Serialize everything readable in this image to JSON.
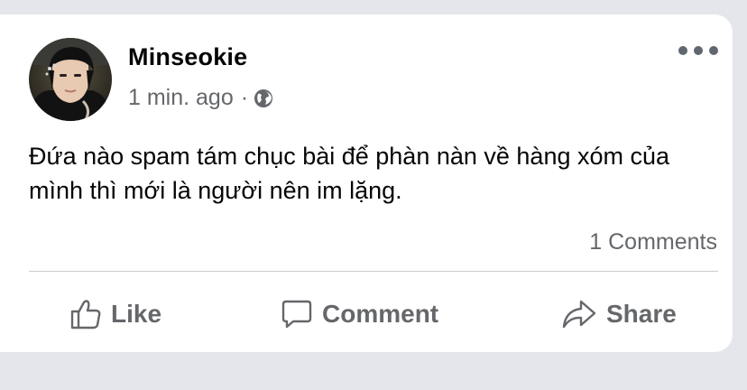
{
  "post": {
    "author": "Minseokie",
    "timestamp": "1 min. ago",
    "separator": "·",
    "privacy_icon": "globe-icon",
    "text": "Đứa nào spam tám chục bài để phàn nàn về hàng xóm của mình thì mới là người nên im lặng.",
    "comments_count": "1 Comments"
  },
  "actions": {
    "like_label": "Like",
    "comment_label": "Comment",
    "share_label": "Share"
  },
  "colors": {
    "background": "#e4e6eb",
    "card": "#ffffff",
    "primary_text": "#050505",
    "secondary_text": "#65676b",
    "divider": "#c9ccd1"
  }
}
